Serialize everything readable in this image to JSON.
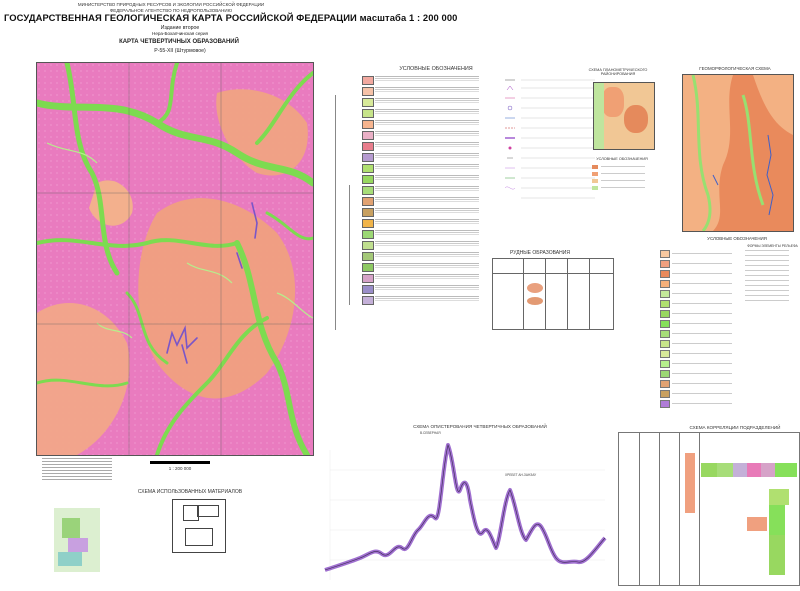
{
  "header": {
    "ministry": "МИНИСТЕРСТВО ПРИРОДНЫХ РЕСУРСОВ И ЭКОЛОГИИ РОССИЙСКОЙ ФЕДЕРАЦИИ\nФЕДЕРАЛЬНОЕ АГЕНТСТВО ПО НЕДРОПОЛЬЗОВАНИЮ",
    "title": "ГОСУДАРСТВЕННАЯ ГЕОЛОГИЧЕСКАЯ КАРТА РОССИЙСКОЙ ФЕДЕРАЦИИ масштаба 1 : 200 000",
    "edition": "Издание второе",
    "series": "Нера-Бохапчинская серия",
    "subtitle": "КАРТА ЧЕТВЕРТИЧНЫХ ОБРАЗОВАНИЙ",
    "sheet": "P-55-XII (Штурмовое)"
  },
  "legend": {
    "title": "УСЛОВНЫЕ ОБОЗНАЧЕНИЯ",
    "swatches": [
      "#f2a9a0",
      "#f6c2a8",
      "#d8ea9a",
      "#c7e48a",
      "#f7b58f",
      "#eab0c6",
      "#e87d8c",
      "#b69bd0",
      "#b0e070",
      "#98d860",
      "#a7dd79",
      "#e1a272",
      "#c8a060",
      "#f0b44a",
      "#9cd874",
      "#c0df8f",
      "#a4c878",
      "#8ec963",
      "#d6a2c8",
      "#9a8ec9",
      "#c4b0d8"
    ]
  },
  "geomorph": {
    "title": "ГЕОМОРФОЛОГИЧЕСКАЯ СХЕМА",
    "legend_title": "УСЛОВНЫЕ ОБОЗНАЧЕНИЯ",
    "col_title": "ФОРМЫ ЭЛЕМЕНТЫ РЕЛЬЕФА"
  },
  "inset_small": {
    "title": "СХЕМА ПЛАНОМЕТРИЧЕСКОГО РАЙОНИРОВАНИЯ",
    "legend_title": "УСЛОВНЫЕ ОБОЗНАЧЕНИЯ"
  },
  "scale": {
    "label": "1 : 200 000"
  },
  "materials": {
    "title": "СХЕМА ИСПОЛЬЗОВАННЫХ МАТЕРИАЛОВ"
  },
  "correlation": {
    "title": "СХЕМА КОРРЕЛЯЦИИ ПОДРАЗДЕЛЕНИЙ"
  },
  "profile": {
    "title": "СХЕМА ОПИСТЕРОВАНИЯ ЧЕТВЕРТИЧНЫХ ОБРАЗОВАНИЙ",
    "left_label": "В.СЕВЕРНАЯ",
    "peak_label": "ХРЕБЕТ АН-ЗАНЗАУ"
  },
  "deposits_table": {
    "title": "РУДНЫЕ ОБРАЗОВАНИЯ"
  },
  "colors": {
    "pink": "#e87ab8",
    "salmon": "#f0a07f",
    "green": "#86e05a",
    "purple": "#b07cd8",
    "frame": "#555555"
  }
}
